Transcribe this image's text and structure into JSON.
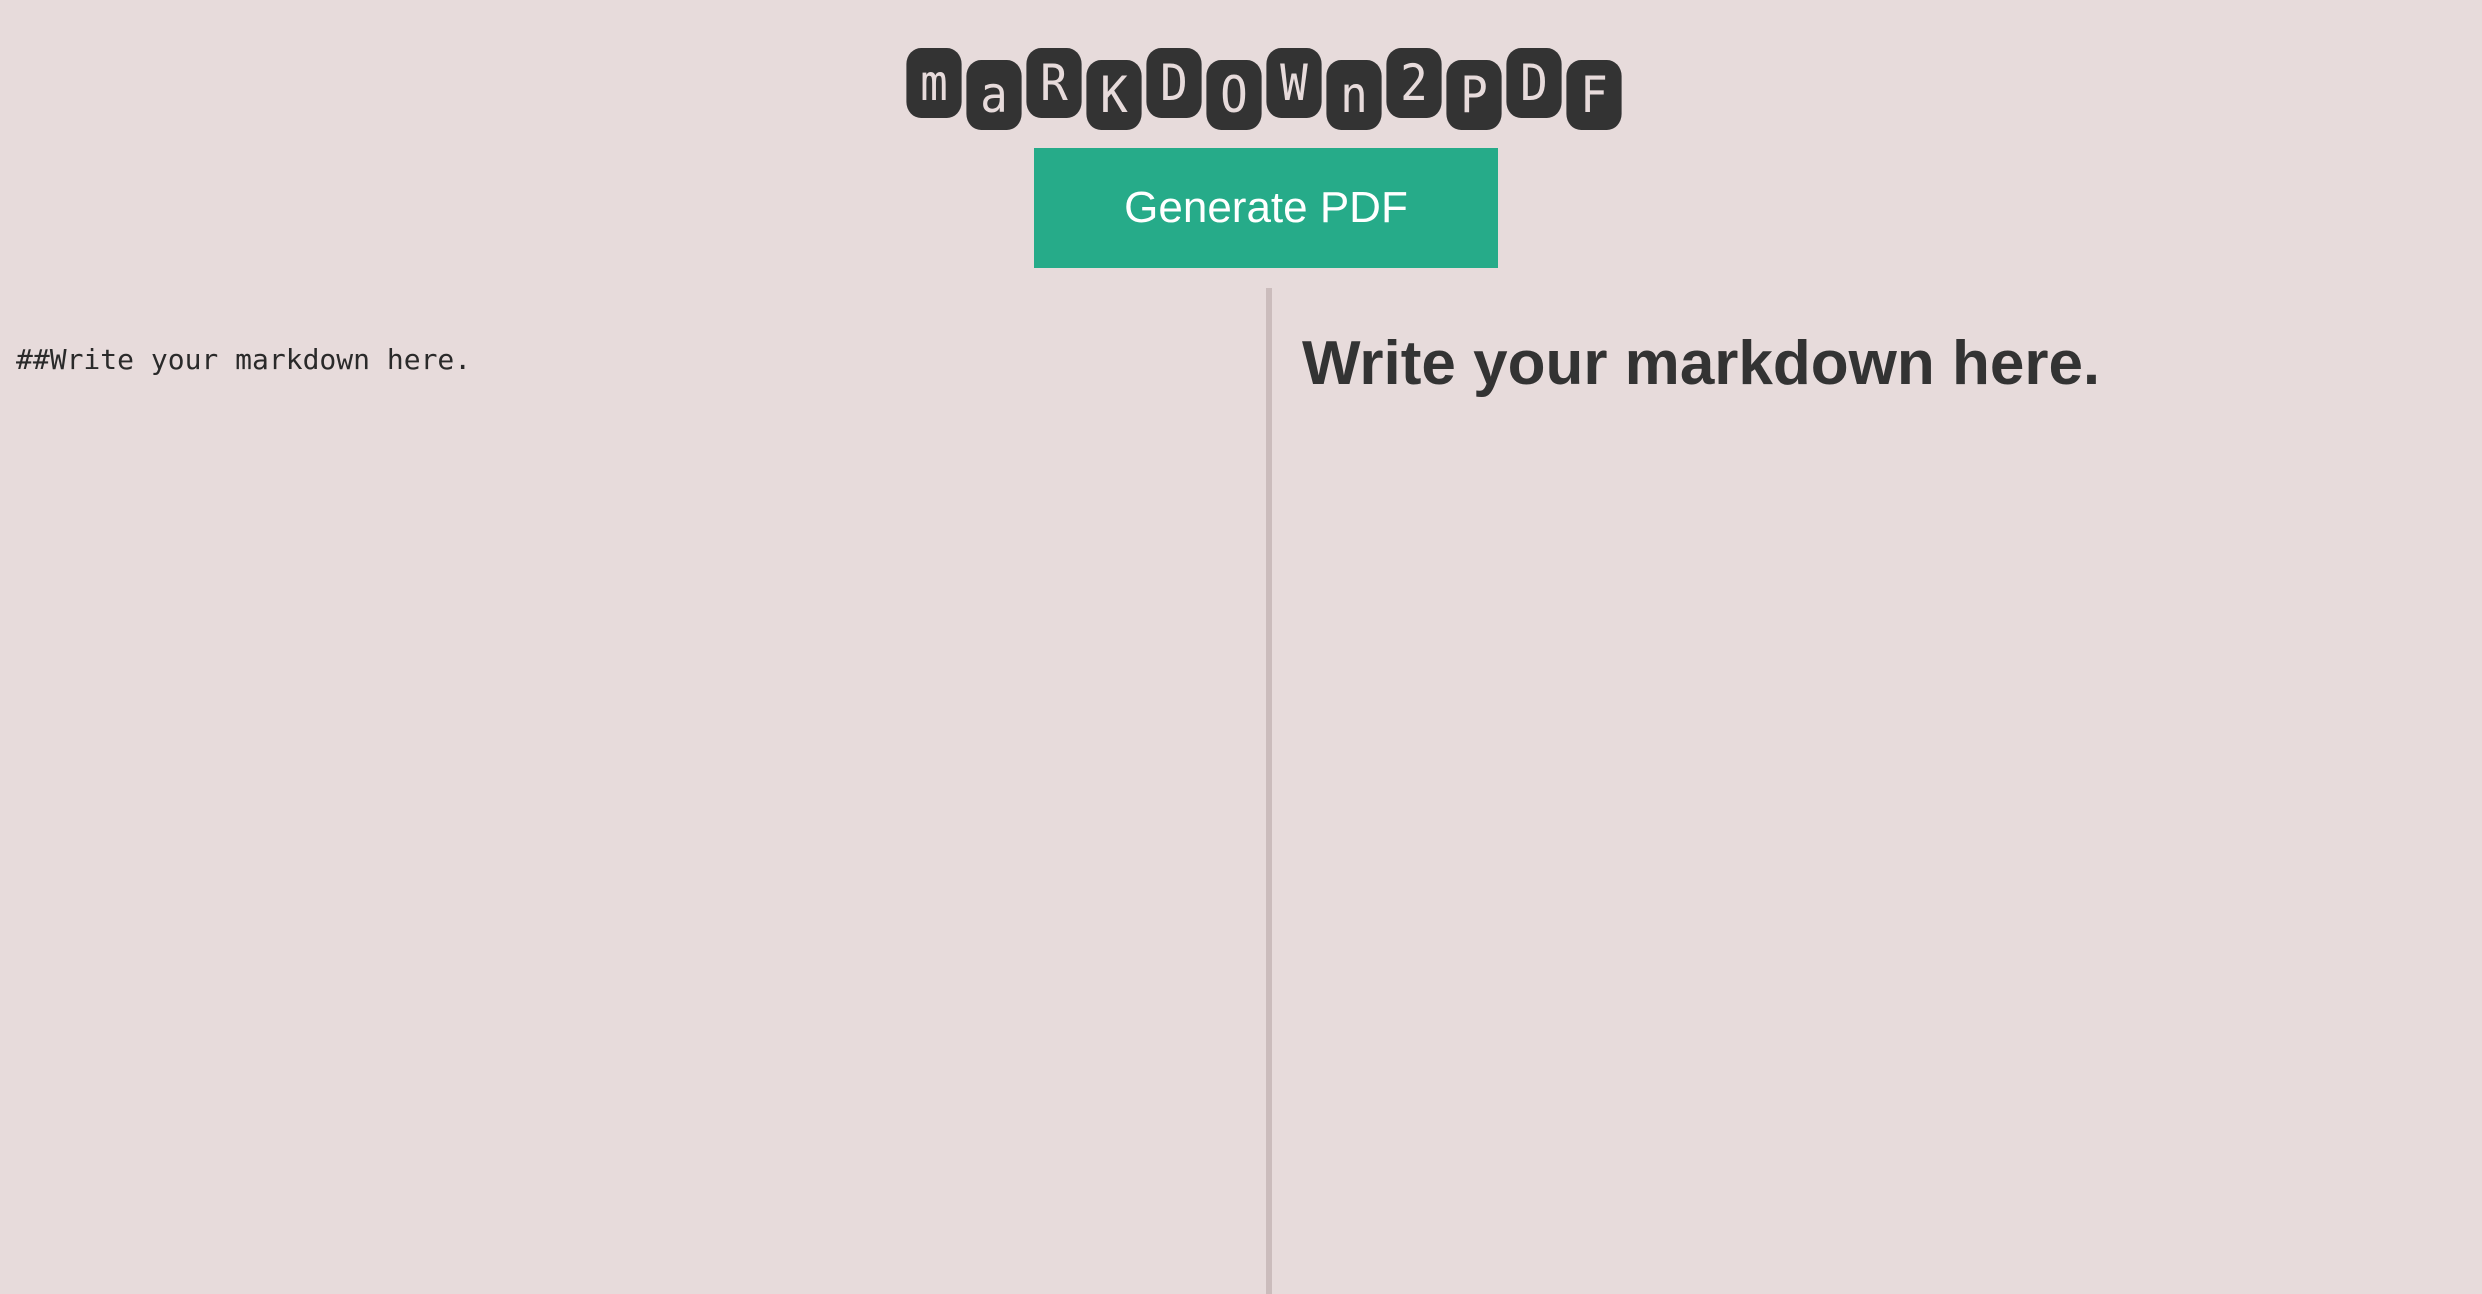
{
  "header": {
    "logo_letters": [
      "m",
      "a",
      "R",
      "K",
      "D",
      "O",
      "W",
      "n",
      "2",
      "P",
      "D",
      "F"
    ],
    "logo_icon": "markdown2pdf-logo",
    "generate_label": "Generate PDF"
  },
  "editor": {
    "value": "##Write your markdown here."
  },
  "preview": {
    "heading": "Write your markdown here."
  },
  "colors": {
    "background": "#e7dbdb",
    "accent": "#26ab89",
    "tile": "#333333",
    "text": "#333333"
  }
}
